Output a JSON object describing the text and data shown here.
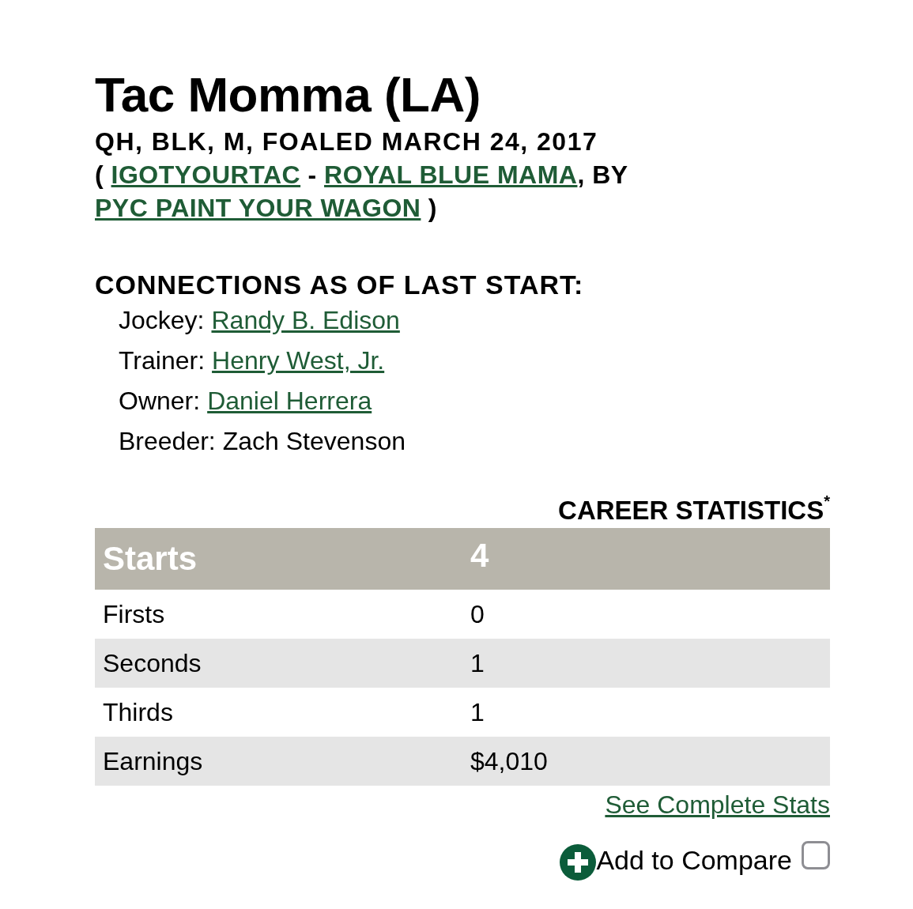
{
  "horse": {
    "name": "Tac Momma (LA)",
    "details": "QH, BLK, M, FOALED MARCH 24, 2017",
    "pedigree": [
      {
        "kind": "text",
        "text": "("
      },
      {
        "kind": "link",
        "text": "IGOTYOURTAC"
      },
      {
        "kind": "text",
        "text": "-"
      },
      {
        "kind": "link",
        "text": "ROYAL BLUE MAMA"
      },
      {
        "kind": "text",
        "text": ", BY"
      },
      {
        "kind": "link",
        "text": "PYC PAINT YOUR WAGON"
      },
      {
        "kind": "text",
        "text": ")"
      }
    ]
  },
  "connections": {
    "title": "CONNECTIONS AS OF LAST START:",
    "items": [
      {
        "label": "Jockey:",
        "value": "Randy B. Edison",
        "kind": "link"
      },
      {
        "label": "Trainer:",
        "value": "Henry West, Jr.",
        "kind": "link"
      },
      {
        "label": "Owner:",
        "value": "Daniel Herrera",
        "kind": "link"
      },
      {
        "label": "Breeder:",
        "value": "Zach Stevenson",
        "kind": "text"
      }
    ]
  },
  "career_statistics": {
    "title": "CAREER STATISTICS$^{*}$",
    "header": {
      "label": "Starts",
      "value": "4"
    },
    "rows": [
      {
        "label": "Firsts",
        "value": "0"
      },
      {
        "label": "Seconds",
        "value": "1"
      },
      {
        "label": "Thirds",
        "value": "1"
      },
      {
        "label": "Earnings",
        "value": "$4,010"
      }
    ],
    "link": "See Complete Stats"
  },
  "compare": {
    "label": "Add to Compare",
    "checked": false
  }
}
